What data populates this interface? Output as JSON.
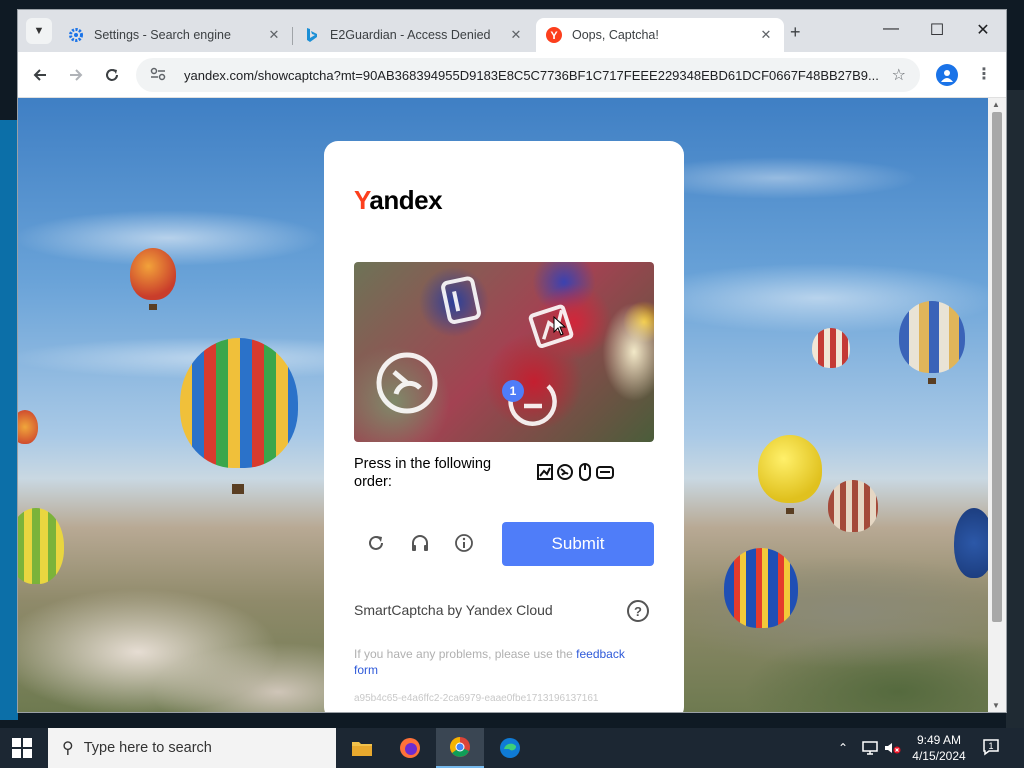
{
  "browser": {
    "tabs": [
      {
        "label": "Settings - Search engine",
        "icon": "gear-icon"
      },
      {
        "label": "E2Guardian - Access Denied",
        "icon": "bing-icon"
      },
      {
        "label": "Oops, Captcha!",
        "icon": "yandex-icon",
        "active": true
      }
    ],
    "url": "yandex.com/showcaptcha?mt=90AB368394955D9183E8C5C7736BF1C717FEEE229348EBD61DCF0667F48BB27B9...",
    "new_tab": "+",
    "min": "—",
    "max": "☐",
    "close": "✕"
  },
  "captcha": {
    "logo_first": "Y",
    "logo_rest": "andex",
    "marker_number": "1",
    "instruction": "Press in the following order:",
    "submit_label": "Submit",
    "brand": "SmartCaptcha by Yandex Cloud",
    "help": "?",
    "feedback_prefix": "If you have any problems, please use the ",
    "feedback_link": "feedback form",
    "hash": "a95b4c65-e4a6ffc2-2ca6979-eaae0fbe1713196137161",
    "accent_color": "#4f7df9",
    "logo_red": "#fc3f1d"
  },
  "taskbar": {
    "search_placeholder": "Type here to search",
    "time": "9:49 AM",
    "date": "4/15/2024",
    "notification_count": "1"
  }
}
